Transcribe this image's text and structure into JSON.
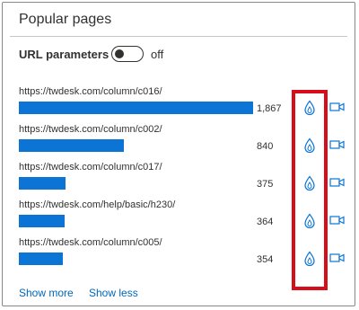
{
  "title": "Popular pages",
  "url_parameters": {
    "label": "URL parameters",
    "state": "off"
  },
  "pages": [
    {
      "url": "https://twdesk.com/column/c016/",
      "count": "1,867",
      "value": 1867
    },
    {
      "url": "https://twdesk.com/column/c002/",
      "count": "840",
      "value": 840
    },
    {
      "url": "https://twdesk.com/column/c017/",
      "count": "375",
      "value": 375
    },
    {
      "url": "https://twdesk.com/help/basic/h230/",
      "count": "364",
      "value": 364
    },
    {
      "url": "https://twdesk.com/column/c005/",
      "count": "354",
      "value": 354
    }
  ],
  "row_icons": {
    "heatmap": "drop-icon",
    "recording": "camera-icon"
  },
  "footer": {
    "show_more": "Show more",
    "show_less": "Show less"
  },
  "colors": {
    "bar": "#0b74d4",
    "highlight": "#d80d1c",
    "link": "#0067b8"
  }
}
